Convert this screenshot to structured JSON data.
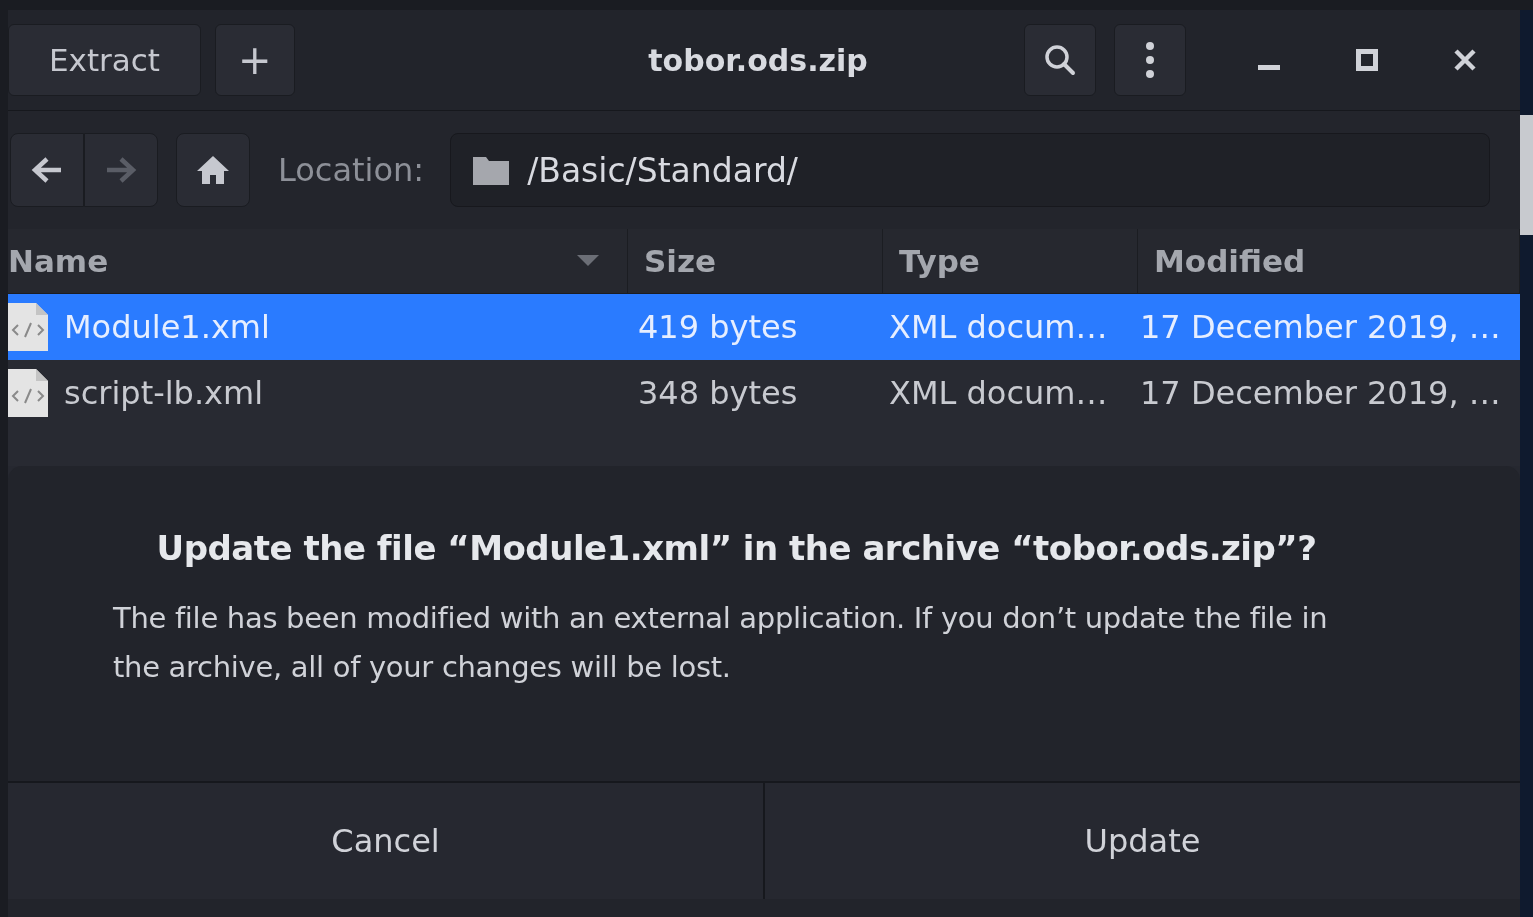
{
  "window": {
    "title": "tobor.ods.zip"
  },
  "headerbar": {
    "buttons": [
      {
        "label": "Extract",
        "kind": "text"
      },
      {
        "label": "+",
        "kind": "text"
      }
    ]
  },
  "toolbar": {
    "nav": [
      {
        "kind": "back",
        "disabled": false
      },
      {
        "kind": "forward",
        "disabled": true
      },
      {
        "kind": "home",
        "disabled": false
      }
    ],
    "location_label": "Location:",
    "location": "/Basic/Standard/"
  },
  "table": {
    "columns": [
      {
        "label": "Name",
        "sorted": true
      },
      {
        "label": "Size",
        "sorted": false
      },
      {
        "label": "Type",
        "sorted": false
      },
      {
        "label": "Modified",
        "sorted": false
      }
    ],
    "rows": [
      {
        "name": "Module1.xml",
        "size": "419 bytes",
        "type": "XML docum…",
        "modified": "17 December 2019, …",
        "selected": true
      },
      {
        "name": "script-lb.xml",
        "size": "348 bytes",
        "type": "XML docum…",
        "modified": "17 December 2019, …",
        "selected": false
      }
    ]
  },
  "dialog": {
    "title": "Update the file “Module1.xml” in the archive “tobor.ods.zip”?",
    "message": "The file has been modified with an external application. If you don’t update the file in the archive, all of your changes will be lost.",
    "buttons": [
      "Cancel",
      "Update"
    ]
  }
}
